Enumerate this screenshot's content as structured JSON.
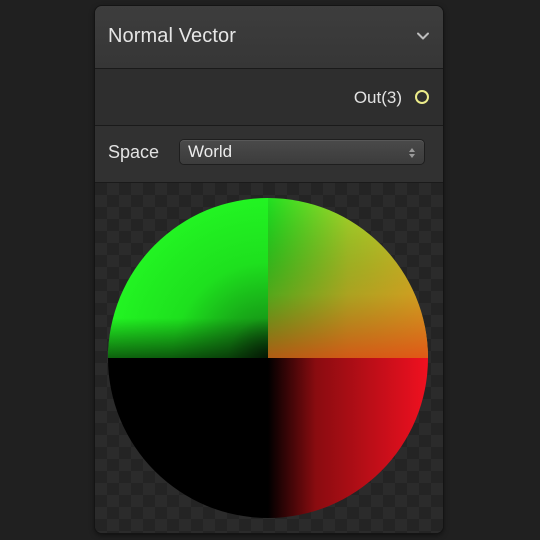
{
  "node": {
    "title": "Normal Vector",
    "collapse_icon": "chevron-down-icon",
    "output": {
      "label": "Out(3)",
      "port_color": "#ecec8a"
    },
    "controls": {
      "space_label": "Space",
      "space_value": "World",
      "dropdown_icon": "updown-arrows-icon"
    },
    "preview": {
      "shape": "sphere",
      "quadrant_colors": {
        "top_left": "#1ef01e",
        "top_right": "#c8d82a",
        "bottom_left": "#000000",
        "bottom_right": "#e8101e"
      }
    }
  }
}
